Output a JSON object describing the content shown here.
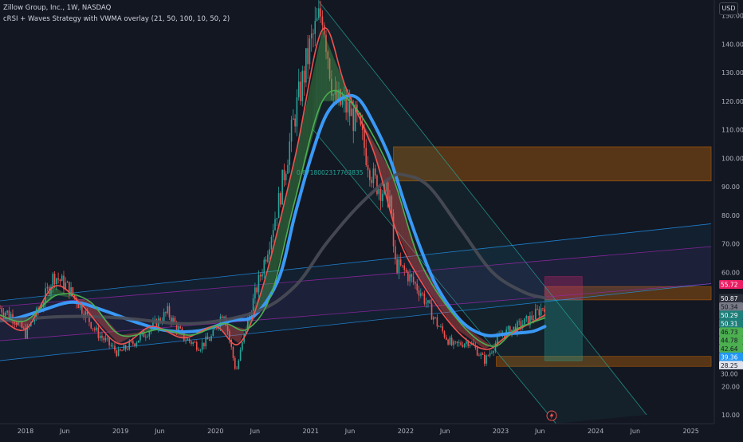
{
  "header": {
    "symbol_line": "Zillow Group, Inc., 1W, NASDAQ",
    "indicator_line": "cRSI + Waves Strategy with VWMA overlay (21, 50, 100, 10, 50, 2)",
    "currency_button": "USD"
  },
  "annotation_text": "0.8718002317763835",
  "chart_data": {
    "type": "candlestick",
    "title": "Zillow Group, Inc., 1W, NASDAQ",
    "timeframe": "1W",
    "y_axis": {
      "ticks": [
        "150.00",
        "140.00",
        "130.00",
        "120.00",
        "110.00",
        "100.00",
        "90.00",
        "80.00",
        "70.00",
        "60.00",
        "50.00",
        "40.00",
        "30.00",
        "20.00",
        "10.00"
      ],
      "range": [
        7,
        155
      ]
    },
    "x_axis": {
      "ticks": [
        "2018",
        "Jun",
        "2019",
        "Jun",
        "2020",
        "Jun",
        "2021",
        "Jun",
        "2022",
        "Jun",
        "2023",
        "Jun",
        "2024",
        "Jun",
        "2025"
      ],
      "range": [
        "2017-09-25",
        "2025-04-01"
      ]
    },
    "price_path": [
      [
        "2017-09-25",
        47.5
      ],
      [
        "2017-11-15",
        44.5
      ],
      [
        "2018-01-01",
        38.5
      ],
      [
        "2018-03-01",
        48
      ],
      [
        "2018-04-20",
        59
      ],
      [
        "2018-06-10",
        55
      ],
      [
        "2018-08-01",
        48
      ],
      [
        "2018-10-01",
        39
      ],
      [
        "2018-12-24",
        31.5
      ],
      [
        "2019-03-01",
        36
      ],
      [
        "2019-05-01",
        40.5
      ],
      [
        "2019-07-01",
        46
      ],
      [
        "2019-09-01",
        37
      ],
      [
        "2019-11-01",
        34
      ],
      [
        "2019-12-20",
        37.5
      ],
      [
        "2020-02-01",
        47
      ],
      [
        "2020-03-20",
        25
      ],
      [
        "2020-05-01",
        42
      ],
      [
        "2020-07-01",
        62
      ],
      [
        "2020-09-01",
        85
      ],
      [
        "2020-11-01",
        115
      ],
      [
        "2021-01-01",
        140
      ],
      [
        "2021-02-15",
        152
      ],
      [
        "2021-04-01",
        120
      ],
      [
        "2021-05-15",
        118
      ],
      [
        "2021-07-01",
        112
      ],
      [
        "2021-09-01",
        92
      ],
      [
        "2021-11-01",
        86
      ],
      [
        "2021-11-20",
        63
      ],
      [
        "2022-01-01",
        60
      ],
      [
        "2022-03-01",
        53
      ],
      [
        "2022-05-01",
        42
      ],
      [
        "2022-07-01",
        34
      ],
      [
        "2022-09-01",
        36
      ],
      [
        "2022-11-01",
        29
      ],
      [
        "2023-01-01",
        38
      ],
      [
        "2023-03-01",
        40.5
      ],
      [
        "2023-05-01",
        44
      ],
      [
        "2023-06-20",
        48.5
      ]
    ],
    "series": [
      {
        "name": "VWMA",
        "color": "#3a99f6",
        "points": [
          [
            "2017-09-25",
            43
          ],
          [
            "2017-12-01",
            44
          ],
          [
            "2018-03-01",
            46.5
          ],
          [
            "2018-07-01",
            49.5
          ],
          [
            "2018-11-01",
            46.5
          ],
          [
            "2019-03-01",
            42.5
          ],
          [
            "2019-07-01",
            39.5
          ],
          [
            "2019-11-01",
            39.5
          ],
          [
            "2020-03-01",
            43
          ],
          [
            "2020-06-01",
            45
          ],
          [
            "2020-09-01",
            58
          ],
          [
            "2020-11-01",
            80
          ],
          [
            "2021-01-01",
            100
          ],
          [
            "2021-03-01",
            115
          ],
          [
            "2021-05-01",
            121
          ],
          [
            "2021-07-01",
            121
          ],
          [
            "2021-09-01",
            112
          ],
          [
            "2021-11-01",
            100
          ],
          [
            "2022-01-01",
            83
          ],
          [
            "2022-03-01",
            68
          ],
          [
            "2022-05-01",
            55
          ],
          [
            "2022-08-01",
            43
          ],
          [
            "2022-11-01",
            38
          ],
          [
            "2023-02-01",
            38.5
          ],
          [
            "2023-05-01",
            39.2
          ],
          [
            "2023-06-20",
            41
          ]
        ]
      },
      {
        "name": "MA 100",
        "color": "#4a4d57",
        "points": [
          [
            "2017-09-25",
            43
          ],
          [
            "2018-06-01",
            44.5
          ],
          [
            "2019-01-01",
            44
          ],
          [
            "2019-10-01",
            42
          ],
          [
            "2020-06-01",
            46
          ],
          [
            "2020-11-01",
            55
          ],
          [
            "2021-03-01",
            70
          ],
          [
            "2021-07-01",
            83
          ],
          [
            "2021-11-01",
            93
          ],
          [
            "2022-01-01",
            94
          ],
          [
            "2022-04-01",
            90
          ],
          [
            "2022-08-01",
            75
          ],
          [
            "2022-12-01",
            60
          ],
          [
            "2023-04-01",
            53
          ],
          [
            "2023-06-20",
            51
          ]
        ]
      },
      {
        "name": "Wave fast",
        "color": "#ef5350",
        "points": [
          [
            "2017-09-25",
            44
          ],
          [
            "2018-01-01",
            40
          ],
          [
            "2018-04-20",
            55
          ],
          [
            "2018-08-01",
            49
          ],
          [
            "2018-12-24",
            35
          ],
          [
            "2019-05-01",
            41
          ],
          [
            "2019-09-01",
            37
          ],
          [
            "2020-01-01",
            41
          ],
          [
            "2020-04-01",
            35
          ],
          [
            "2020-07-01",
            55
          ],
          [
            "2020-11-01",
            100
          ],
          [
            "2021-02-15",
            145
          ],
          [
            "2021-05-15",
            125
          ],
          [
            "2021-09-01",
            102
          ],
          [
            "2021-11-20",
            76
          ],
          [
            "2022-02-01",
            61
          ],
          [
            "2022-07-01",
            41
          ],
          [
            "2022-11-01",
            33
          ],
          [
            "2023-02-01",
            38
          ],
          [
            "2023-06-20",
            45
          ]
        ]
      },
      {
        "name": "Wave slow",
        "color": "#4caf50",
        "points": [
          [
            "2017-09-25",
            45
          ],
          [
            "2018-01-01",
            43
          ],
          [
            "2018-05-01",
            52
          ],
          [
            "2018-09-01",
            50
          ],
          [
            "2019-01-01",
            38
          ],
          [
            "2019-06-01",
            40
          ],
          [
            "2019-10-01",
            38
          ],
          [
            "2020-02-01",
            42
          ],
          [
            "2020-05-01",
            40
          ],
          [
            "2020-08-01",
            52
          ],
          [
            "2020-11-01",
            85
          ],
          [
            "2021-02-15",
            120
          ],
          [
            "2021-06-01",
            120
          ],
          [
            "2021-11-01",
            96
          ],
          [
            "2022-03-01",
            63
          ],
          [
            "2022-08-01",
            42
          ],
          [
            "2022-12-01",
            34
          ],
          [
            "2023-03-01",
            40
          ],
          [
            "2023-06-20",
            44
          ]
        ]
      }
    ],
    "price_labels": [
      {
        "value": "55.72",
        "color": "#e91e63",
        "text_color": "#ffffff"
      },
      {
        "value": "50.87",
        "color": "#2a2e39",
        "text_color": "#ffffff"
      },
      {
        "value": "50.34",
        "color": "#787b86",
        "text_color": "#131722"
      },
      {
        "value": "50.29",
        "color": "#1e7f7a",
        "text_color": "#ffffff"
      },
      {
        "value": "50.31",
        "color": "#1e7f7a",
        "text_color": "#ffffff"
      },
      {
        "value": "46.73",
        "color": "#4caf50",
        "text_color": "#131722"
      },
      {
        "value": "44.78",
        "color": "#4caf50",
        "text_color": "#131722"
      },
      {
        "value": "42.64",
        "color": "#4caf50",
        "text_color": "#131722"
      },
      {
        "value": "39.36",
        "color": "#2196f3",
        "text_color": "#ffffff"
      },
      {
        "value": "28.25",
        "color": "#e0e3eb",
        "text_color": "#131722"
      },
      {
        "value": "30.00",
        "color": "#131722",
        "text_color": "#b2b5be"
      }
    ],
    "zones": [
      {
        "name": "supply-zone",
        "from": "2021-11-15",
        "to": "2025-03-20",
        "y": [
          92,
          104
        ],
        "color": "#f57c00"
      },
      {
        "name": "resistance-zone",
        "from": "2023-06-20",
        "to": "2025-03-20",
        "y": [
          50.3,
          55
        ],
        "color": "#f57c00"
      },
      {
        "name": "demand-zone",
        "from": "2022-12-15",
        "to": "2025-03-20",
        "y": [
          27,
          30.5
        ],
        "color": "#f57c00"
      },
      {
        "name": "long-target",
        "from": "2023-06-20",
        "to": "2023-11-10",
        "y": [
          50.3,
          58.5
        ],
        "color": "#e91e63"
      },
      {
        "name": "long-stop",
        "from": "2023-06-20",
        "to": "2023-11-10",
        "y": [
          29,
          50.3
        ],
        "color": "#26a69a"
      }
    ],
    "channels": [
      {
        "name": "descending-channel",
        "color": "#26a69a",
        "lines": [
          [
            [
              "2021-02-01",
              155
            ],
            [
              "2024-07-15",
              10
            ]
          ],
          [
            [
              "2021-01-10",
              110
            ],
            [
              "2023-08-01",
              7
            ]
          ]
        ]
      },
      {
        "name": "ascending-channel",
        "color": "#2196f3",
        "lines": [
          [
            [
              "2017-09-25",
              50
            ],
            [
              "2025-03-20",
              77
            ]
          ],
          [
            [
              "2017-09-25",
              29
            ],
            [
              "2025-03-20",
              56
            ]
          ]
        ]
      },
      {
        "name": "purple-channel",
        "color": "#9c27b0",
        "lines": [
          [
            [
              "2017-09-25",
              48
            ],
            [
              "2025-03-20",
              69
            ]
          ],
          [
            [
              "2017-09-25",
              36
            ],
            [
              "2025-03-20",
              56
            ]
          ]
        ]
      }
    ],
    "grid": false,
    "legend": "none"
  }
}
